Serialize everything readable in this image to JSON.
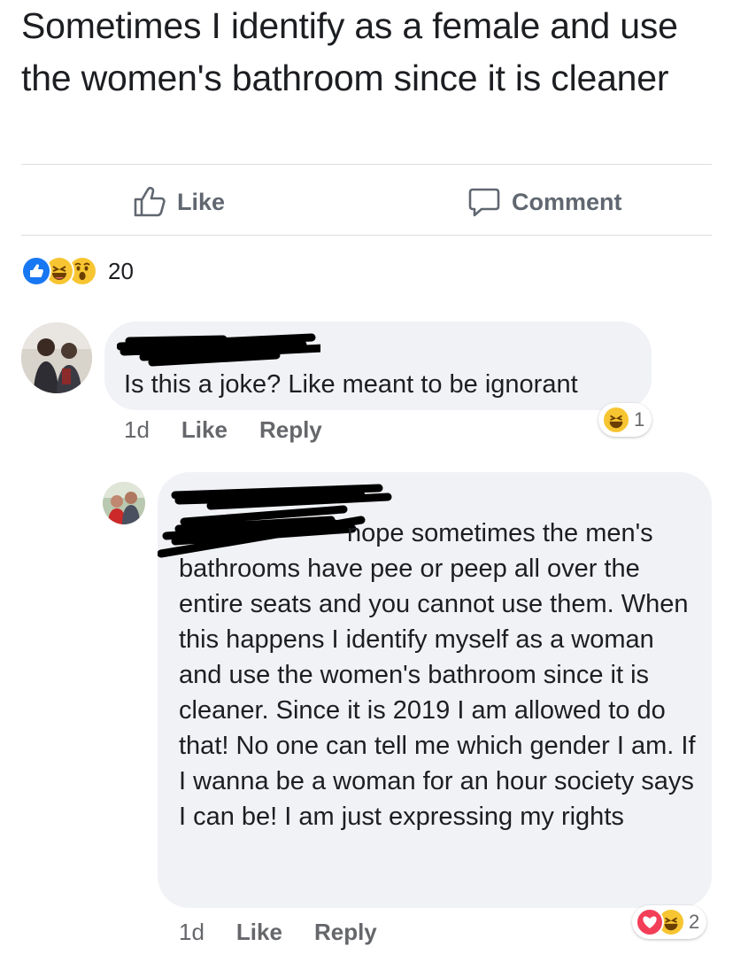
{
  "post": {
    "text": "Sometimes I identify as a female and use the women's bathroom since it is cleaner"
  },
  "actions": {
    "like_label": "Like",
    "comment_label": "Comment"
  },
  "reactions": {
    "icons": [
      "like-icon",
      "haha-icon",
      "wow-icon"
    ],
    "count": "20"
  },
  "comments": [
    {
      "text": "Is this a joke? Like meant to be ignorant",
      "time": "1d",
      "like_label": "Like",
      "reply_label": "Reply",
      "reaction_icons": [
        "haha-icon"
      ],
      "reaction_count": "1"
    },
    {
      "text": "nope sometimes the men's bathrooms have pee or peep all over the entire seats and you cannot use them. When this happens I identify myself as a woman and use the women's bathroom since it is cleaner. Since it is 2019 I am allowed to do that! No one can tell me which gender I am. If I wanna be a woman for an hour society says I can be! I am just expressing my rights",
      "time": "1d",
      "like_label": "Like",
      "reply_label": "Reply",
      "reaction_icons": [
        "love-icon",
        "haha-icon"
      ],
      "reaction_count": "2"
    }
  ],
  "colors": {
    "like_blue": "#1877f2",
    "haha_yellow": "#f7c531",
    "love_red": "#f33e58",
    "bubble_gray": "#f0f2f5",
    "meta_gray": "#65676b"
  }
}
